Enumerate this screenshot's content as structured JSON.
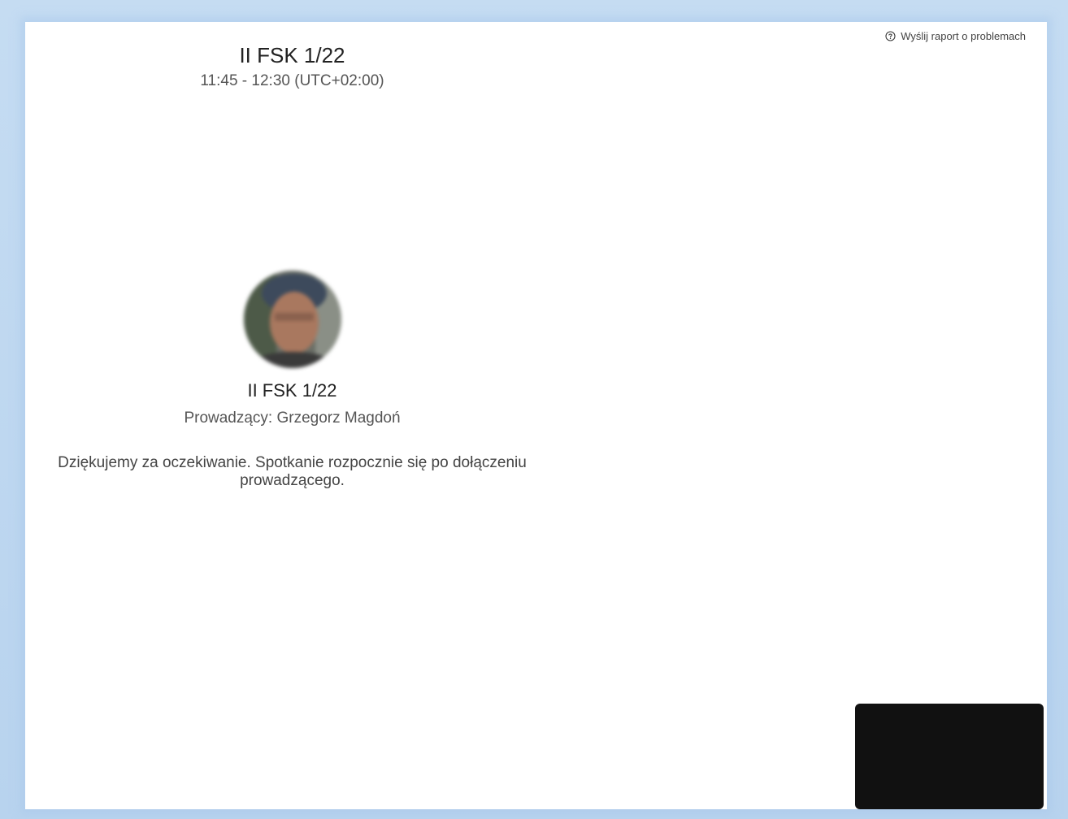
{
  "report": {
    "label": "Wyślij raport o problemach",
    "icon": "help-circle-icon"
  },
  "meeting": {
    "title": "II FSK 1/22",
    "time": "11:45 - 12:30 (UTC+02:00)"
  },
  "lobby": {
    "title": "II FSK 1/22",
    "host": "Prowadzący: Grzegorz Magdoń",
    "message": "Dziękujemy za oczekiwanie. Spotkanie rozpocznie się po dołączeniu prowadzącego."
  },
  "colors": {
    "frame": "#c5dcf2",
    "self_video_bg": "#111111"
  }
}
